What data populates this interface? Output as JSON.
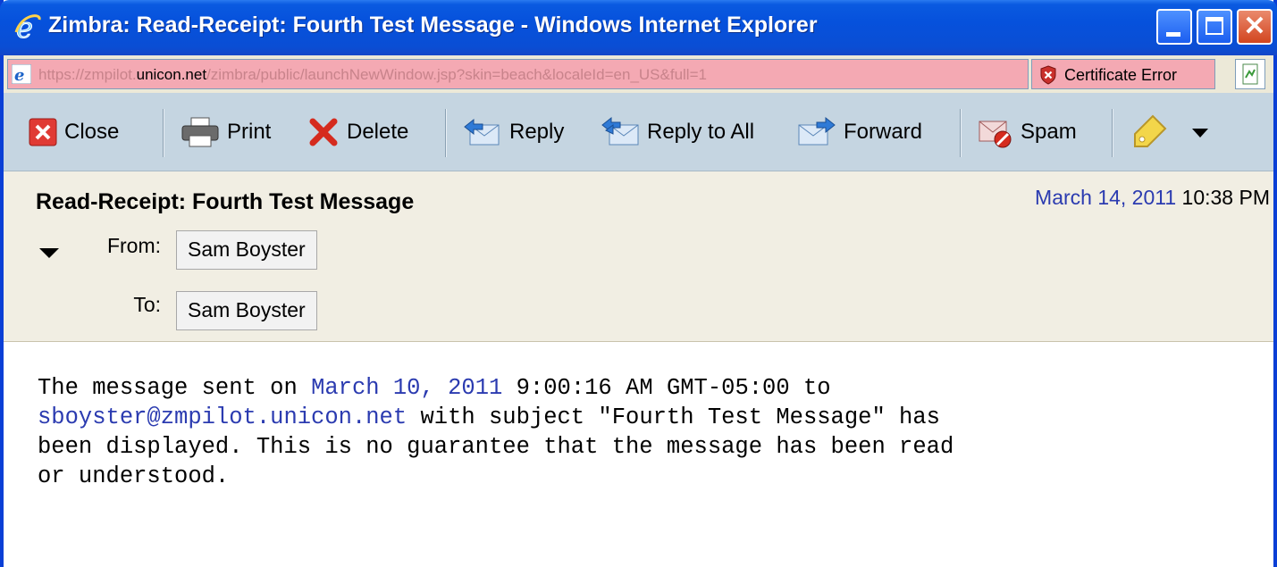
{
  "window": {
    "title": "Zimbra: Read-Receipt: Fourth Test Message - Windows Internet Explorer",
    "controls": {
      "minimize": "minimize",
      "maximize": "maximize",
      "close_glyph": "✕"
    }
  },
  "addressbar": {
    "url_prefix": "https://zmpilot.",
    "url_domain": "unicon.net",
    "url_suffix": "/zimbra/public/launchNewWindow.jsp?skin=beach&localeId=en_US&full=1",
    "certificate_label": "Certificate Error"
  },
  "toolbar": {
    "close_label": "Close",
    "print_label": "Print",
    "delete_label": "Delete",
    "reply_label": "Reply",
    "reply_all_label": "Reply to All",
    "forward_label": "Forward",
    "spam_label": "Spam"
  },
  "message": {
    "subject": "Read-Receipt: Fourth Test Message",
    "date": "March 14, 2011",
    "time": "10:38 PM",
    "from_label": "From:",
    "from_name": "Sam Boyster",
    "to_label": "To:",
    "to_name": "Sam Boyster",
    "body": {
      "part1": "The message sent on ",
      "date_link": "March 10, 2011",
      "part2": " 9:00:16 AM GMT-05:00 to",
      "email_link": "sboyster@zmpilot.unicon.net",
      "part3": " with subject \"Fourth Test Message\" has",
      "line3": "been displayed. This is no guarantee that the message has been read",
      "line4": "or understood."
    }
  },
  "colors": {
    "title_bar": "#0651dc",
    "address_error": "#f4a9b3",
    "toolbar": "#c5d5e1",
    "header": "#f1eee3",
    "link": "#2b3bb0"
  }
}
